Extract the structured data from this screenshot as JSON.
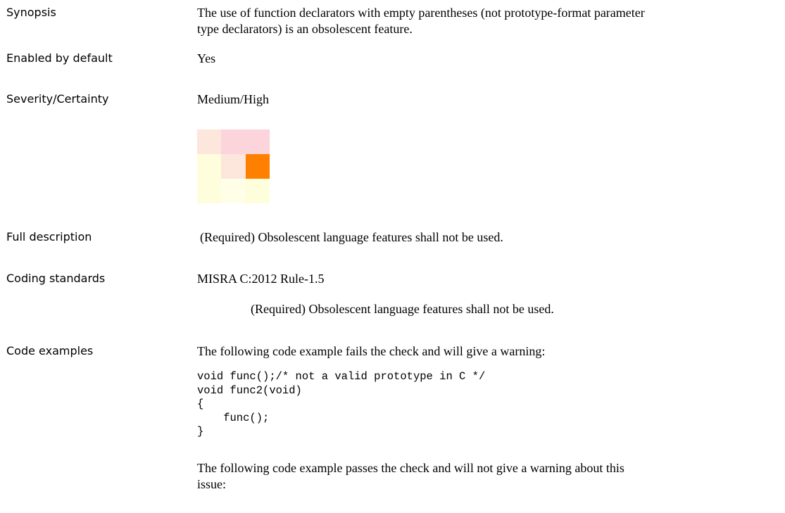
{
  "rows": {
    "synopsis": {
      "label": "Synopsis",
      "line1": "The use of function declarators with empty parentheses (not prototype-format parameter",
      "line2": "type declarators) is an obsolescent feature."
    },
    "enabled": {
      "label": "Enabled by default",
      "value": "Yes"
    },
    "severity": {
      "label": "Severity/Certainty",
      "value": "Medium/High",
      "matrix_colors": [
        [
          "#fde6dc",
          "#fcd4dc",
          "#fcd4dc"
        ],
        [
          "#fffedc",
          "#fde6dc",
          "#ff7f00"
        ],
        [
          "#fffedc",
          "#fffee6",
          "#fffedc"
        ]
      ]
    },
    "full_description": {
      "label": "Full description",
      "value": "(Required) Obsolescent language features shall not be used."
    },
    "coding_standards": {
      "label": "Coding standards",
      "standard": "MISRA C:2012 Rule-1.5",
      "detail": "(Required) Obsolescent language features shall not be used."
    },
    "code_examples": {
      "label": "Code examples",
      "fail_intro": "The following code example fails the check and will give a warning:",
      "fail_code": "void func();/* not a valid prototype in C */\nvoid func2(void)\n{\n    func();\n}",
      "pass_intro_line1": "The following code example passes the check and will not give a warning about this",
      "pass_intro_line2": "issue:"
    }
  }
}
